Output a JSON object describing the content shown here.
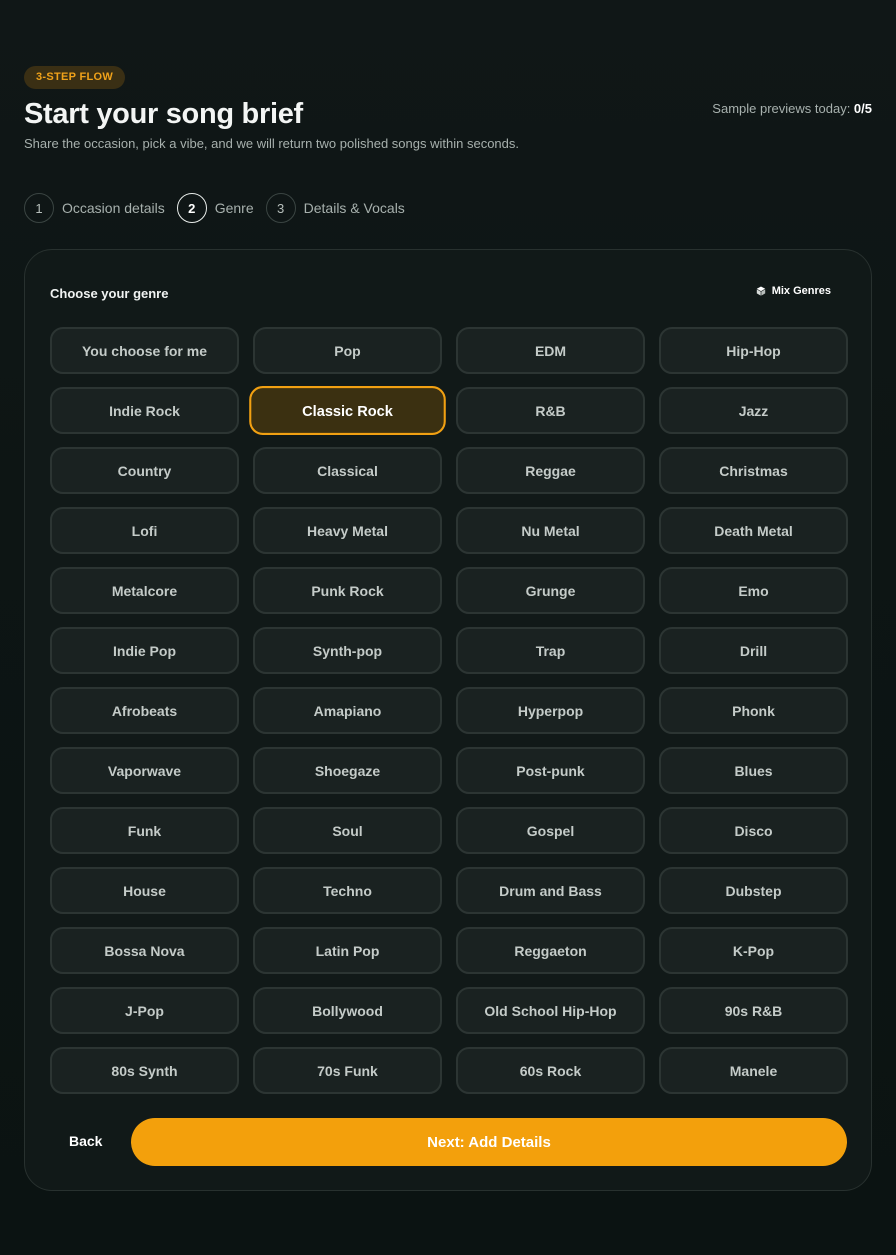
{
  "header": {
    "badge": "3-STEP FLOW",
    "title": "Start your song brief",
    "subtitle": "Share the occasion, pick a vibe, and we will return two polished songs within seconds.",
    "previews_label": "Sample previews today: ",
    "previews_count": "0/5"
  },
  "steps": [
    {
      "num": "1",
      "label": "Occasion details"
    },
    {
      "num": "2",
      "label": "Genre"
    },
    {
      "num": "3",
      "label": "Details & Vocals"
    }
  ],
  "panel": {
    "title": "Choose your genre",
    "mix_label": "Mix Genres",
    "mix_icon": "cube-icon"
  },
  "genres": [
    "You choose for me",
    "Pop",
    "EDM",
    "Hip-Hop",
    "Indie Rock",
    "Classic Rock",
    "R&B",
    "Jazz",
    "Country",
    "Classical",
    "Reggae",
    "Christmas",
    "Lofi",
    "Heavy Metal",
    "Nu Metal",
    "Death Metal",
    "Metalcore",
    "Punk Rock",
    "Grunge",
    "Emo",
    "Indie Pop",
    "Synth-pop",
    "Trap",
    "Drill",
    "Afrobeats",
    "Amapiano",
    "Hyperpop",
    "Phonk",
    "Vaporwave",
    "Shoegaze",
    "Post-punk",
    "Blues",
    "Funk",
    "Soul",
    "Gospel",
    "Disco",
    "House",
    "Techno",
    "Drum and Bass",
    "Dubstep",
    "Bossa Nova",
    "Latin Pop",
    "Reggaeton",
    "K-Pop",
    "J-Pop",
    "Bollywood",
    "Old School Hip-Hop",
    "90s R&B",
    "80s Synth",
    "70s Funk",
    "60s Rock",
    "Manele"
  ],
  "selected_genre": "Classic Rock",
  "footer": {
    "back_label": "Back",
    "next_label": "Next: Add Details"
  },
  "colors": {
    "accent": "#f3a00c",
    "selected_bg": "#3b3011",
    "background": "#0d1514"
  }
}
